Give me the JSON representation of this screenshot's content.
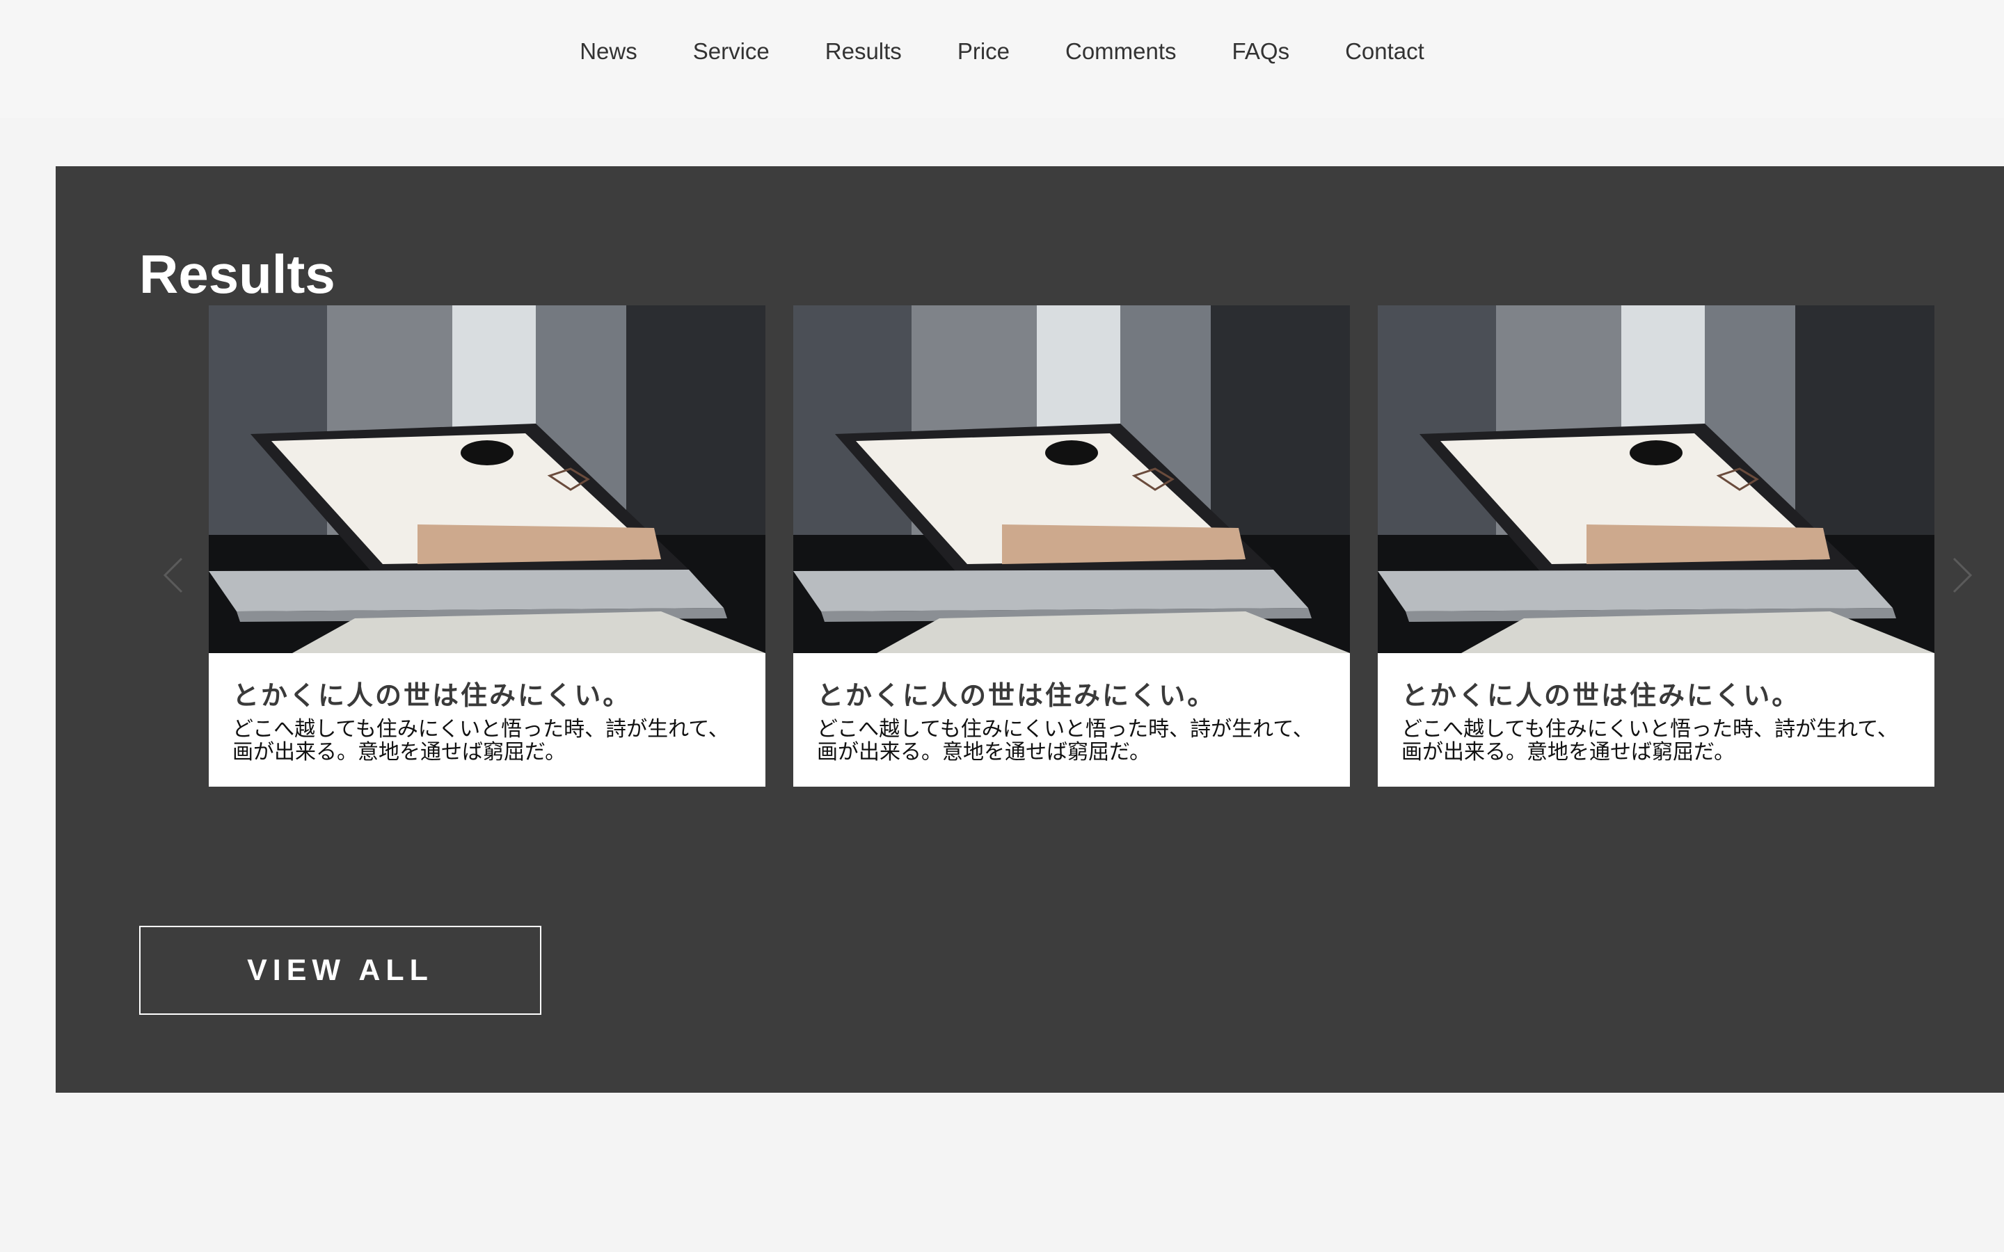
{
  "nav": {
    "items": [
      {
        "label": "News"
      },
      {
        "label": "Service"
      },
      {
        "label": "Results"
      },
      {
        "label": "Price"
      },
      {
        "label": "Comments"
      },
      {
        "label": "FAQs"
      },
      {
        "label": "Contact"
      }
    ]
  },
  "results": {
    "title": "Results",
    "cards": [
      {
        "title": "とかくに人の世は住みにくい。",
        "text": "どこへ越しても住みにくいと悟った時、詩が生れて、画が出来る。意地を通せば窮屈だ。",
        "image_icon": "laptop-photo"
      },
      {
        "title": "とかくに人の世は住みにくい。",
        "text": "どこへ越しても住みにくいと悟った時、詩が生れて、画が出来る。意地を通せば窮屈だ。",
        "image_icon": "laptop-photo"
      },
      {
        "title": "とかくに人の世は住みにくい。",
        "text": "どこへ越しても住みにくいと悟った時、詩が生れて、画が出来る。意地を通せば窮屈だ。",
        "image_icon": "laptop-photo"
      }
    ],
    "prev_icon": "chevron-left-icon",
    "next_icon": "chevron-right-icon",
    "view_all_label": "VIEW ALL"
  },
  "colors": {
    "page_background": "#f4f4f4",
    "section_background": "#3d3d3d",
    "card_background": "#ffffff",
    "nav_text": "#333333"
  }
}
